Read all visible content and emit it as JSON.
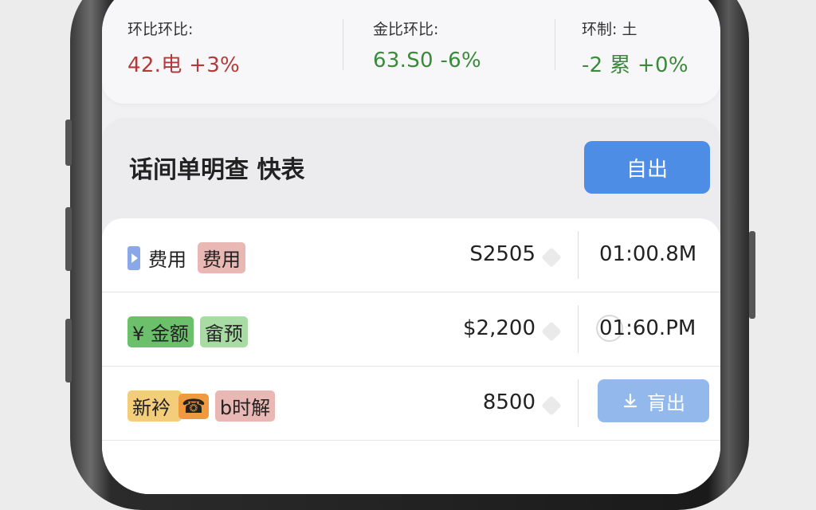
{
  "stats": [
    {
      "label": "环比环比:",
      "value": "42.电 +3%",
      "color": "#b23a3a"
    },
    {
      "label": "金比环比:",
      "value": "63.S0 -6%",
      "color": "#3a8a3a"
    },
    {
      "label": "环制: 土",
      "value": "-2 累 +0%",
      "color": "#3a8a3a"
    }
  ],
  "panel": {
    "title": "话间单明查 快表",
    "export_label": "自出"
  },
  "rows": [
    {
      "tags": [
        "费用",
        "费用"
      ],
      "amount": "S2505",
      "time": "01:00.8M"
    },
    {
      "tags": [
        "¥ 金额",
        "畲预"
      ],
      "amount": "$2,200",
      "time": "01:60.PM"
    },
    {
      "tags": [
        "新衿",
        "b时解"
      ],
      "amount": "8500",
      "action_label": "肓出"
    }
  ],
  "colors": {
    "accent": "#4d8de6",
    "accent_light": "#93b9ec",
    "tag_red": "#eab8b4",
    "tag_green": "#6cc06c",
    "tag_green_light": "#a8dca4",
    "tag_yellow": "#f3cd7a",
    "tag_orange": "#ef9a3e"
  },
  "icons": [
    "play-icon",
    "phone-icon",
    "download-icon"
  ]
}
